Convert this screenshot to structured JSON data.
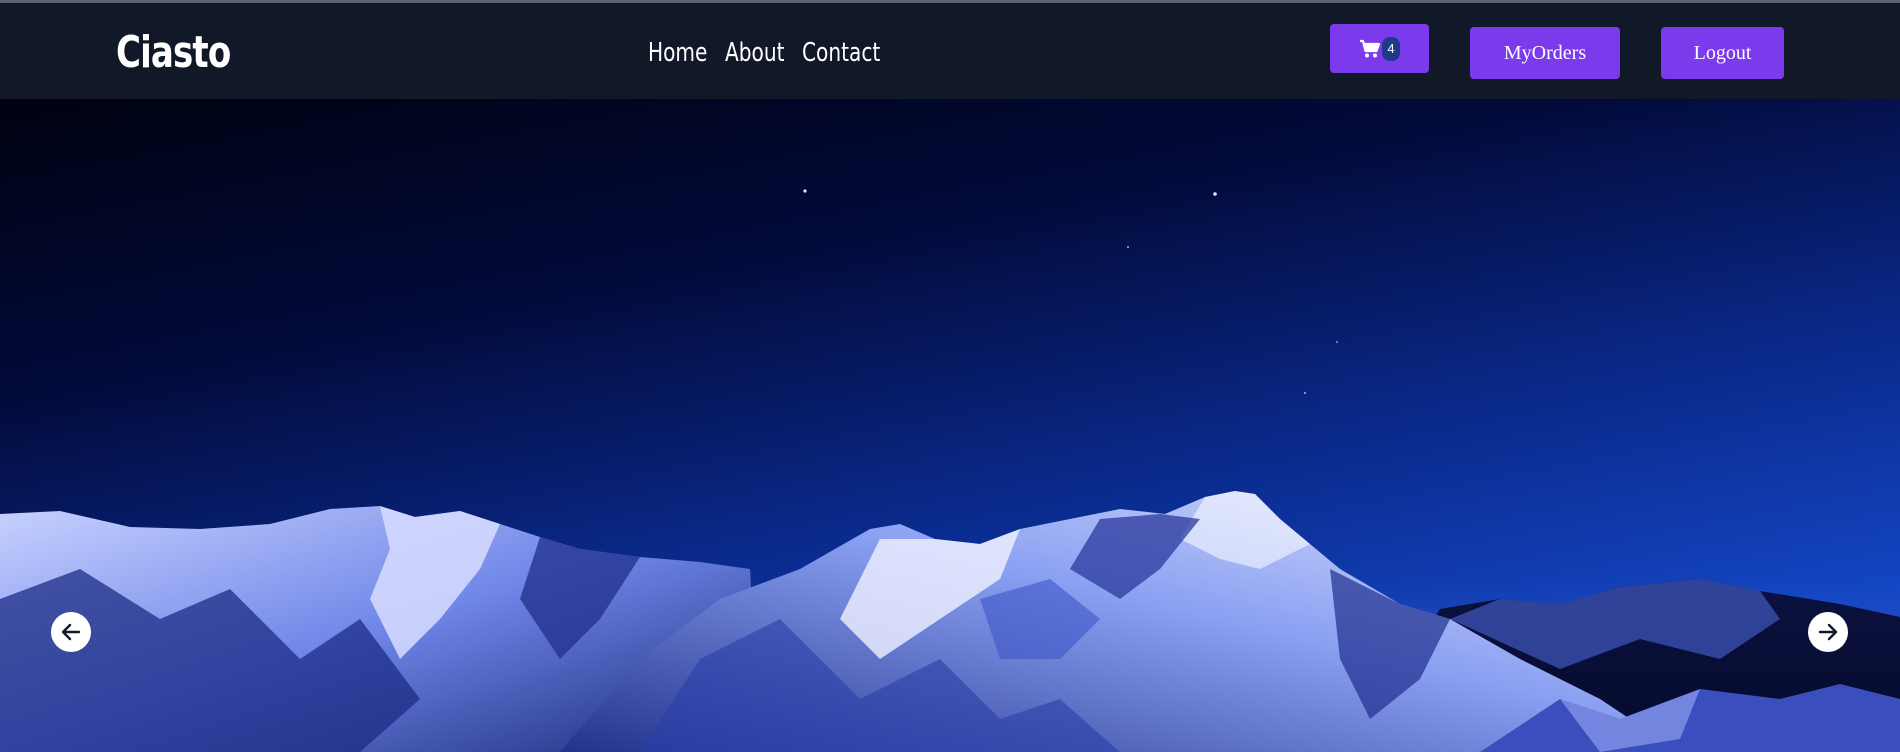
{
  "brand": {
    "name": "Ciasto"
  },
  "nav": {
    "links": [
      {
        "label": "Home"
      },
      {
        "label": "About"
      },
      {
        "label": "Contact"
      }
    ]
  },
  "header_actions": {
    "cart": {
      "icon": "shopping-cart-icon",
      "count": "4"
    },
    "orders_label": "MyOrders",
    "logout_label": "Logout"
  },
  "carousel": {
    "prev_icon": "arrow-left-icon",
    "next_icon": "arrow-right-icon",
    "slide_image": "night-snowy-mountains"
  },
  "colors": {
    "navbar_bg": "#111827",
    "accent": "#7c3aed",
    "badge": "#1e3a8a"
  }
}
